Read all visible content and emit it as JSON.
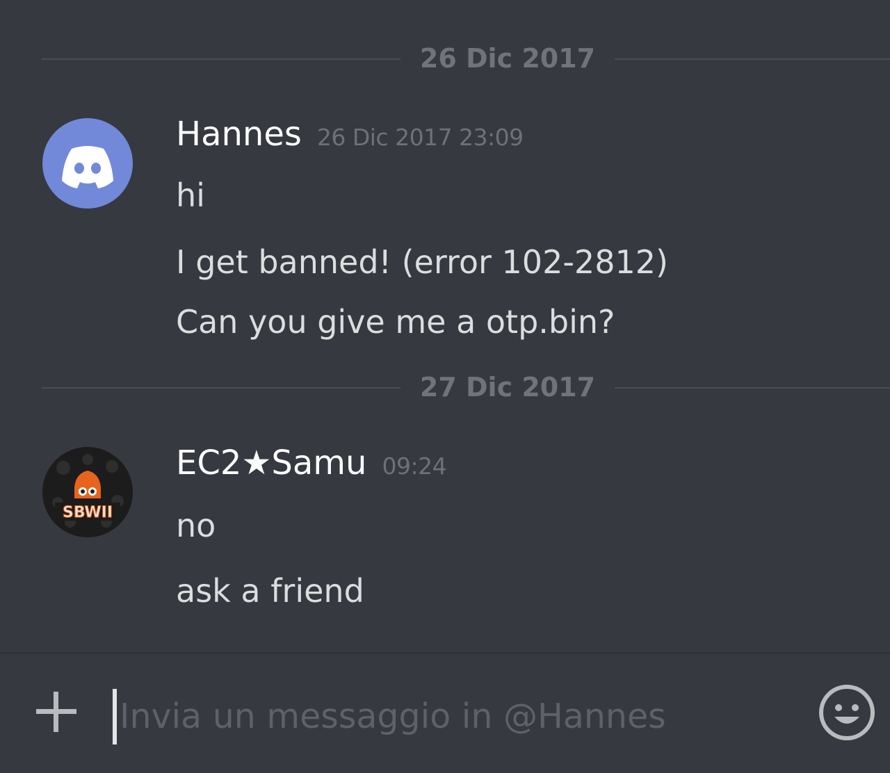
{
  "dividers": [
    "26 Dic 2017",
    "27 Dic 2017"
  ],
  "groups": [
    {
      "username": "Hannes",
      "timestamp": "26 Dic 2017 23:09",
      "avatar_icon": "discord-logo-icon",
      "messages": [
        "hi",
        "I get banned! (error 102-2812)",
        "Can you give me a otp.bin?"
      ]
    },
    {
      "username": "EC2★Samu",
      "timestamp": "09:24",
      "avatar_icon": "sbwii-logo-icon",
      "avatar_text": "SBWII",
      "messages": [
        "no",
        "ask a friend"
      ]
    }
  ],
  "composer": {
    "placeholder": "Invia un messaggio in @Hannes",
    "add_icon": "plus-icon",
    "emoji_icon": "emoji-smile-icon"
  },
  "colors": {
    "background": "#36393f",
    "blurple": "#7289da",
    "sbwii_orange": "#e8641e"
  }
}
